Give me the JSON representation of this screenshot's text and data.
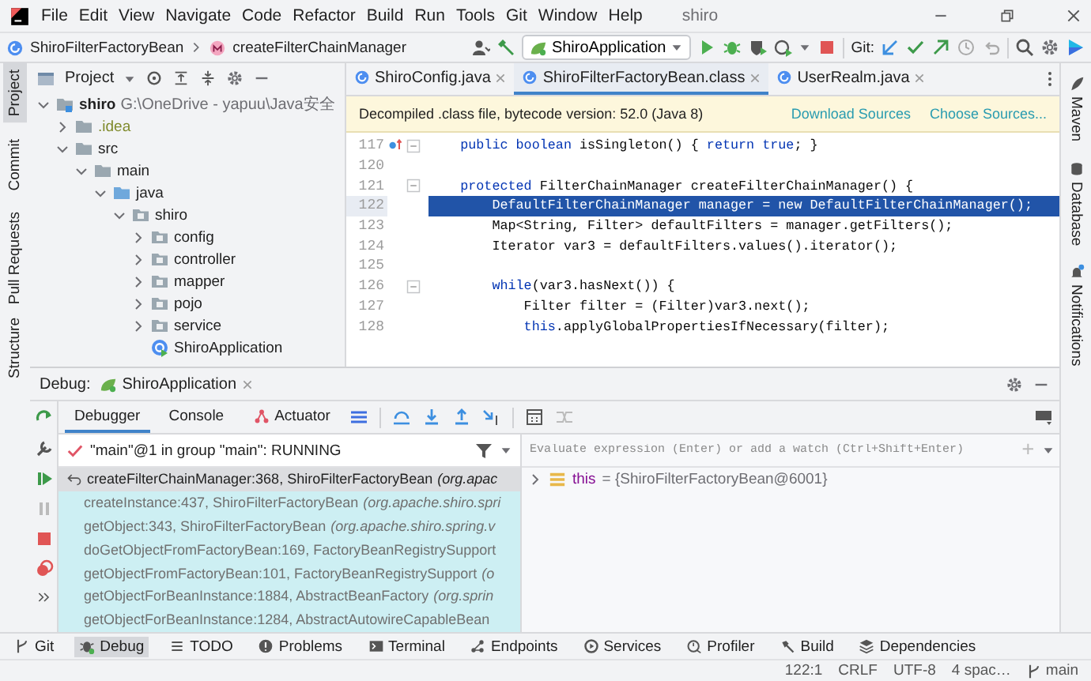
{
  "window": {
    "title": "shiro"
  },
  "menu": [
    "File",
    "Edit",
    "View",
    "Navigate",
    "Code",
    "Refactor",
    "Build",
    "Run",
    "Tools",
    "Git",
    "Window",
    "Help"
  ],
  "breadcrumb": [
    "ShiroFilterFactoryBean",
    "createFilterChainManager"
  ],
  "run_config": "ShiroApplication",
  "git_label": "Git:",
  "left_stripe": [
    {
      "label": "Project",
      "selected": true
    },
    {
      "label": "Commit",
      "selected": false
    },
    {
      "label": "Pull Requests",
      "selected": false
    }
  ],
  "left_stripe_bottom": [
    {
      "label": "Structure",
      "selected": false
    }
  ],
  "right_stripe": [
    {
      "label": "Maven",
      "kind": "maven"
    },
    {
      "label": "Database",
      "kind": "database"
    },
    {
      "label": "Notifications",
      "kind": "bell"
    }
  ],
  "project_panel": {
    "title": "Project",
    "tree": [
      {
        "label": "shiro",
        "kind": "module",
        "path": "G:\\OneDrive - yapuu\\Java安全",
        "expanded": true,
        "ignored": false,
        "children": [
          {
            "label": ".idea",
            "kind": "folder",
            "expanded": false,
            "ignored": true
          },
          {
            "label": "src",
            "kind": "folder",
            "expanded": true,
            "ignored": false,
            "children": [
              {
                "label": "main",
                "kind": "folder",
                "expanded": true,
                "ignored": false,
                "children": [
                  {
                    "label": "java",
                    "kind": "source-root",
                    "expanded": true,
                    "ignored": false,
                    "children": [
                      {
                        "label": "shiro",
                        "kind": "package",
                        "expanded": true,
                        "ignored": false,
                        "children": [
                          {
                            "label": "config",
                            "kind": "package",
                            "expanded": false,
                            "ignored": false
                          },
                          {
                            "label": "controller",
                            "kind": "package",
                            "expanded": false,
                            "ignored": false
                          },
                          {
                            "label": "mapper",
                            "kind": "package",
                            "expanded": false,
                            "ignored": false
                          },
                          {
                            "label": "pojo",
                            "kind": "package",
                            "expanded": false,
                            "ignored": false
                          },
                          {
                            "label": "service",
                            "kind": "package",
                            "expanded": false,
                            "ignored": false
                          },
                          {
                            "label": "ShiroApplication",
                            "kind": "class",
                            "ignored": false
                          }
                        ]
                      }
                    ]
                  }
                ]
              }
            ]
          }
        ]
      }
    ]
  },
  "editor": {
    "tabs": [
      {
        "label": "ShiroConfig.java",
        "selected": false
      },
      {
        "label": "ShiroFilterFactoryBean.class",
        "selected": true
      },
      {
        "label": "UserRealm.java",
        "selected": false
      }
    ],
    "banner": {
      "text": "Decompiled .class file, bytecode version: 52.0 (Java 8)",
      "links": [
        "Download Sources",
        "Choose Sources..."
      ]
    },
    "lines": [
      {
        "number": "117",
        "selected": false,
        "fold": true,
        "override": true,
        "segments": [
          {
            "text": "    public boolean",
            "keyword": true
          },
          {
            "text": " isSingleton() { ",
            "keyword": false
          },
          {
            "text": "return true",
            "keyword": true
          },
          {
            "text": "; }",
            "keyword": false
          }
        ]
      },
      {
        "number": "120",
        "selected": false,
        "fold": false,
        "override": false
      },
      {
        "number": "121",
        "selected": false,
        "fold": true,
        "override": false,
        "segments": [
          {
            "text": "    protected",
            "keyword": true
          },
          {
            "text": " FilterChainManager createFilterChainManager() {",
            "keyword": false
          }
        ]
      },
      {
        "number": "122",
        "selected": true,
        "fold": false,
        "override": false,
        "segments": [
          {
            "text": "        DefaultFilterChainManager manager = ",
            "keyword": false
          },
          {
            "text": "new",
            "keyword": true
          },
          {
            "text": " DefaultFilterChainManager();",
            "keyword": false
          }
        ]
      },
      {
        "number": "123",
        "selected": false,
        "fold": false,
        "override": false,
        "segments": [
          {
            "text": "        Map<String, Filter> defaultFilters = manager.getFilters();",
            "keyword": false
          }
        ]
      },
      {
        "number": "124",
        "selected": false,
        "fold": false,
        "override": false,
        "segments": [
          {
            "text": "        Iterator var3 = defaultFilters.values().iterator();",
            "keyword": false
          }
        ]
      },
      {
        "number": "125",
        "selected": false,
        "fold": false,
        "override": false
      },
      {
        "number": "126",
        "selected": false,
        "fold": true,
        "override": false,
        "segments": [
          {
            "text": "        while",
            "keyword": true
          },
          {
            "text": "(var3.hasNext()) {",
            "keyword": false
          }
        ]
      },
      {
        "number": "127",
        "selected": false,
        "fold": false,
        "override": false,
        "segments": [
          {
            "text": "            Filter filter = (Filter)var3.next();",
            "keyword": false
          }
        ]
      },
      {
        "number": "128",
        "selected": false,
        "fold": false,
        "override": false,
        "segments": [
          {
            "text": "            this",
            "keyword": true
          },
          {
            "text": ".applyGlobalPropertiesIfNecessary(filter);",
            "keyword": false
          }
        ]
      }
    ]
  },
  "debug": {
    "title": "Debug:",
    "session_tab": "ShiroApplication",
    "tabs": [
      {
        "label": "Debugger",
        "selected": true
      },
      {
        "label": "Console",
        "selected": false
      },
      {
        "label": "Actuator",
        "selected": false
      }
    ],
    "thread": "\"main\"@1 in group \"main\": RUNNING",
    "frames": [
      {
        "method": "createFilterChainManager:368, ShiroFilterFactoryBean",
        "package": "(org.apac",
        "selected": true
      },
      {
        "method": "createInstance:437, ShiroFilterFactoryBean",
        "package": "(org.apache.shiro.spri",
        "selected": false
      },
      {
        "method": "getObject:343, ShiroFilterFactoryBean",
        "package": "(org.apache.shiro.spring.v",
        "selected": false
      },
      {
        "method": "doGetObjectFromFactoryBean:169, FactoryBeanRegistrySupport",
        "selected": false
      },
      {
        "method": "getObjectFromFactoryBean:101, FactoryBeanRegistrySupport",
        "package": "(o",
        "selected": false
      },
      {
        "method": "getObjectForBeanInstance:1884, AbstractBeanFactory",
        "package": "(org.sprin",
        "selected": false
      },
      {
        "method": "getObjectForBeanInstance:1284, AbstractAutowireCapableBean",
        "selected": false
      }
    ],
    "watch_placeholder": "Evaluate expression (Enter) or add a watch (Ctrl+Shift+Enter)",
    "variables": [
      {
        "name": "this",
        "value": "= {ShiroFilterFactoryBean@6001}"
      }
    ]
  },
  "tool_windows": [
    {
      "label": "Git",
      "kind": "git",
      "selected": false
    },
    {
      "label": "Debug",
      "kind": "debug",
      "selected": true
    },
    {
      "label": "TODO",
      "kind": "list",
      "selected": false
    },
    {
      "label": "Problems",
      "kind": "problems",
      "selected": false
    },
    {
      "label": "Terminal",
      "kind": "terminal",
      "selected": false
    },
    {
      "label": "Endpoints",
      "kind": "endpoints",
      "selected": false
    },
    {
      "label": "Services",
      "kind": "services",
      "selected": false
    },
    {
      "label": "Profiler",
      "kind": "profiler",
      "selected": false
    },
    {
      "label": "Build",
      "kind": "build",
      "selected": false
    },
    {
      "label": "Dependencies",
      "kind": "layers",
      "selected": false
    }
  ],
  "status_bar": [
    "122:1",
    "CRLF",
    "UTF-8",
    "4 spac…",
    "main"
  ]
}
